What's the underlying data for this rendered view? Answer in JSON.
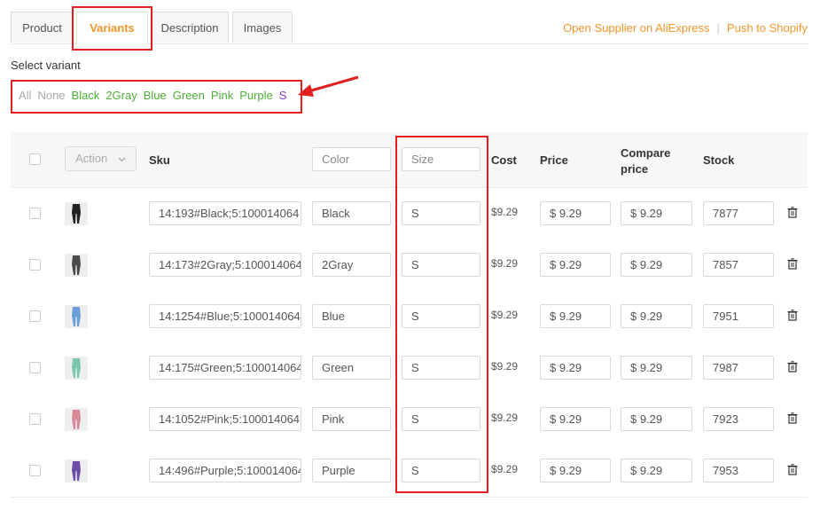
{
  "tabs": [
    {
      "label": "Product",
      "active": false
    },
    {
      "label": "Variants",
      "active": true
    },
    {
      "label": "Description",
      "active": false
    },
    {
      "label": "Images",
      "active": false
    }
  ],
  "links": {
    "supplier": "Open Supplier on AliExpress",
    "separator": "|",
    "push": "Push to Shopify"
  },
  "select_variant_label": "Select variant",
  "filters": {
    "all": "All",
    "none": "None",
    "black": "Black",
    "gray": "2Gray",
    "blue": "Blue",
    "green": "Green",
    "pink": "Pink",
    "purple": "Purple",
    "size": "S"
  },
  "header": {
    "action": "Action",
    "sku": "Sku",
    "color_placeholder": "Color",
    "size_placeholder": "Size",
    "cost": "Cost",
    "price": "Price",
    "compare_line1": "Compare",
    "compare_line2": "price",
    "stock": "Stock"
  },
  "rows": [
    {
      "sku": "14:193#Black;5:100014064",
      "color": "Black",
      "size": "S",
      "cost": "$9.29",
      "price": "$ 9.29",
      "compare": "$ 9.29",
      "stock": "7877",
      "thumb_color": "#222222"
    },
    {
      "sku": "14:173#2Gray;5:100014064",
      "color": "2Gray",
      "size": "S",
      "cost": "$9.29",
      "price": "$ 9.29",
      "compare": "$ 9.29",
      "stock": "7857",
      "thumb_color": "#4a4a4a"
    },
    {
      "sku": "14:1254#Blue;5:100014064",
      "color": "Blue",
      "size": "S",
      "cost": "$9.29",
      "price": "$ 9.29",
      "compare": "$ 9.29",
      "stock": "7951",
      "thumb_color": "#6a9ed8"
    },
    {
      "sku": "14:175#Green;5:100014064",
      "color": "Green",
      "size": "S",
      "cost": "$9.29",
      "price": "$ 9.29",
      "compare": "$ 9.29",
      "stock": "7987",
      "thumb_color": "#7cc6b0"
    },
    {
      "sku": "14:1052#Pink;5:100014064",
      "color": "Pink",
      "size": "S",
      "cost": "$9.29",
      "price": "$ 9.29",
      "compare": "$ 9.29",
      "stock": "7923",
      "thumb_color": "#d98a9a"
    },
    {
      "sku": "14:496#Purple;5:100014064",
      "color": "Purple",
      "size": "S",
      "cost": "$9.29",
      "price": "$ 9.29",
      "compare": "$ 9.29",
      "stock": "7953",
      "thumb_color": "#6d4fa8"
    }
  ]
}
